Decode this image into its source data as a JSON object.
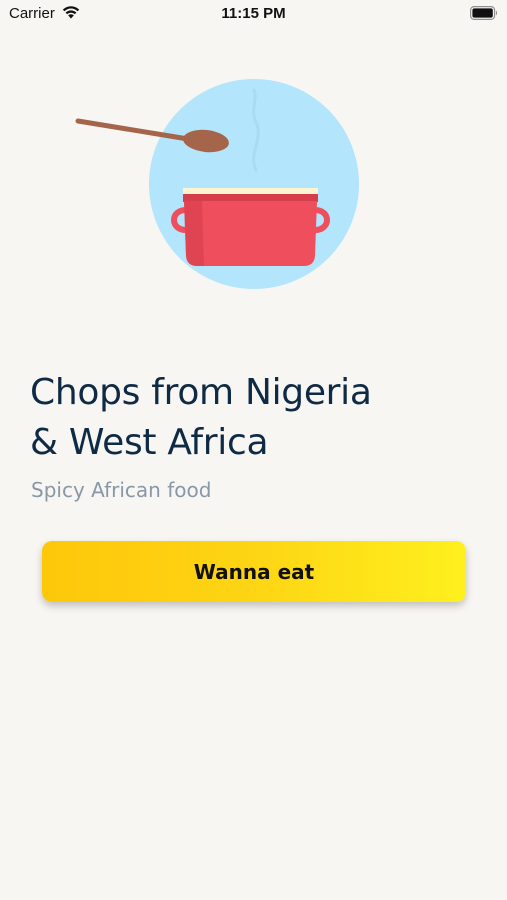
{
  "status_bar": {
    "carrier": "Carrier",
    "time": "11:15 PM",
    "wifi_icon": "wifi-icon",
    "battery_icon": "battery-icon"
  },
  "hero": {
    "illustration": "cooking-pot-illustration",
    "colors": {
      "circle": "#b3e5fc",
      "pot": "#ef4f5c",
      "lid": "#fff4d0",
      "spoon": "#a5654a"
    }
  },
  "headline": {
    "line1": "Chops from Nigeria",
    "line2": "& West Africa"
  },
  "subtitle": "Spicy African food",
  "cta": {
    "label": "Wanna eat",
    "colors": {
      "gradient_start": "#fec70a",
      "gradient_end": "#fef01e"
    }
  }
}
